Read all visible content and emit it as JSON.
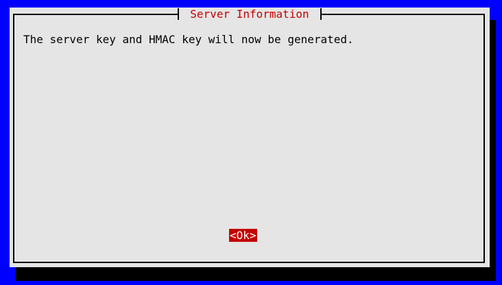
{
  "dialog": {
    "title": "Server Information",
    "message": "The server key and HMAC key will now be generated.",
    "ok_label": "<Ok>"
  },
  "colors": {
    "background": "#0000ff",
    "dialog_bg": "#e5e5e5",
    "title_text": "#c40000",
    "button_bg": "#c40000",
    "button_text": "#ffffff",
    "shadow": "#000000"
  }
}
